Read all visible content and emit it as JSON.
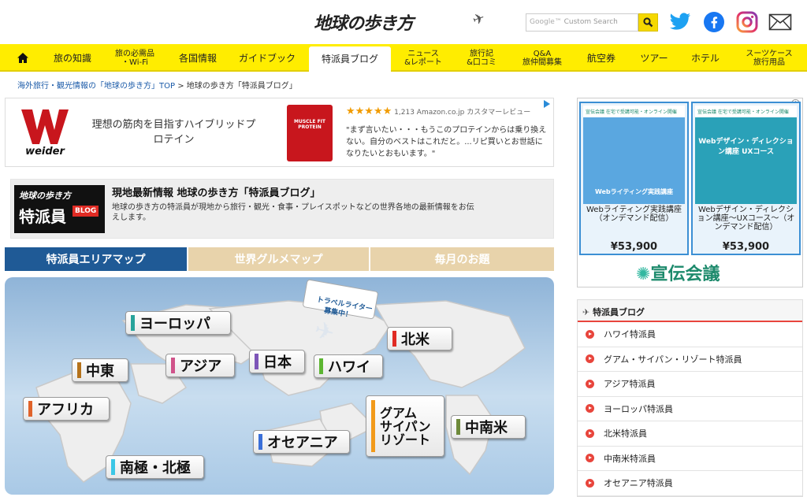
{
  "header": {
    "logo": "地球の歩き方",
    "search_placeholder": "Custom Search",
    "search_brand": "Google™"
  },
  "nav": [
    {
      "label": "旅の知識"
    },
    {
      "label": "旅の必需品\n・Wi-Fi"
    },
    {
      "label": "各国情報"
    },
    {
      "label": "ガイドブック"
    },
    {
      "label": "特派員ブログ",
      "active": true
    },
    {
      "label": "ニュース\n&レポート"
    },
    {
      "label": "旅行記\n&口コミ"
    },
    {
      "label": "Q&A\n旅仲間募集"
    },
    {
      "label": "航空券"
    },
    {
      "label": "ツアー"
    },
    {
      "label": "ホテル"
    },
    {
      "label": "スーツケース\n旅行用品"
    }
  ],
  "breadcrumb": {
    "home": "海外旅行・観光情報の「地球の歩き方」TOP",
    "sep": ">",
    "current": "地球の歩き方「特派員ブログ」"
  },
  "ad_top": {
    "brand": "weider",
    "text": "理想の筋肉を目指すハイブリッドプロテイン",
    "pack_label": "MUSCLE FIT PROTEIN",
    "review_count": "1,213 Amazon.co.jp カスタマーレビュー",
    "quote": "\"まず言いたい・・・もうこのプロテインからは乗り換えない。自分のベストはこれだと。...リピ買いとお世話になりたいとおもいます。\""
  },
  "blog_intro": {
    "logo_line1": "地球の歩き方",
    "logo_line2": "特派員",
    "logo_badge": "BLOG",
    "title": "現地最新情報 地球の歩き方「特派員ブログ」",
    "desc": "地球の歩き方の特派員が現地から旅行・観光・食事・プレイスポットなどの世界各地の最新情報をお伝えします。"
  },
  "tabs": [
    {
      "label": "特派員エリアマップ",
      "color": "#1f5a96"
    },
    {
      "label": "世界グルメマップ",
      "color": "#e8d3ab"
    },
    {
      "label": "毎月のお題",
      "color": "#e8d3ab"
    }
  ],
  "map": {
    "writer_badge": "トラベルライター\n募集中！",
    "regions": [
      {
        "label": "ヨーロッパ",
        "color": "#27a39b"
      },
      {
        "label": "中東",
        "color": "#b5721a"
      },
      {
        "label": "アジア",
        "color": "#d0538a"
      },
      {
        "label": "日本",
        "color": "#7d55b8"
      },
      {
        "label": "ハワイ",
        "color": "#5cb531"
      },
      {
        "label": "北米",
        "color": "#e02b24"
      },
      {
        "label": "アフリカ",
        "color": "#e0632a"
      },
      {
        "label": "グアム\nサイパン\nリゾート",
        "color": "#f29a1a"
      },
      {
        "label": "中南米",
        "color": "#6e8a3a"
      },
      {
        "label": "オセアニア",
        "color": "#3a6fd8"
      },
      {
        "label": "南極・北極",
        "color": "#3cc7e6"
      }
    ]
  },
  "side_ad": {
    "tag": "宣伝会議 在宅で受講可能・オンライン開催",
    "courses": [
      {
        "img_title": "Webライティング実践講座",
        "name": "Webライティング実践講座（オンデマンド配信）",
        "price": "¥53,900"
      },
      {
        "img_title": "Webデザイン・ディレクション講座 UXコース",
        "name": "Webデザイン・ディレクション講座〜UXコース〜（オンデマンド配信）",
        "price": "¥53,900"
      }
    ],
    "brand": "宣伝会議"
  },
  "side_blog": {
    "heading": "特派員ブログ",
    "items": [
      "ハワイ特派員",
      "グアム・サイパン・リゾート特派員",
      "アジア特派員",
      "ヨーロッパ特派員",
      "北米特派員",
      "中南米特派員",
      "オセアニア特派員"
    ]
  }
}
